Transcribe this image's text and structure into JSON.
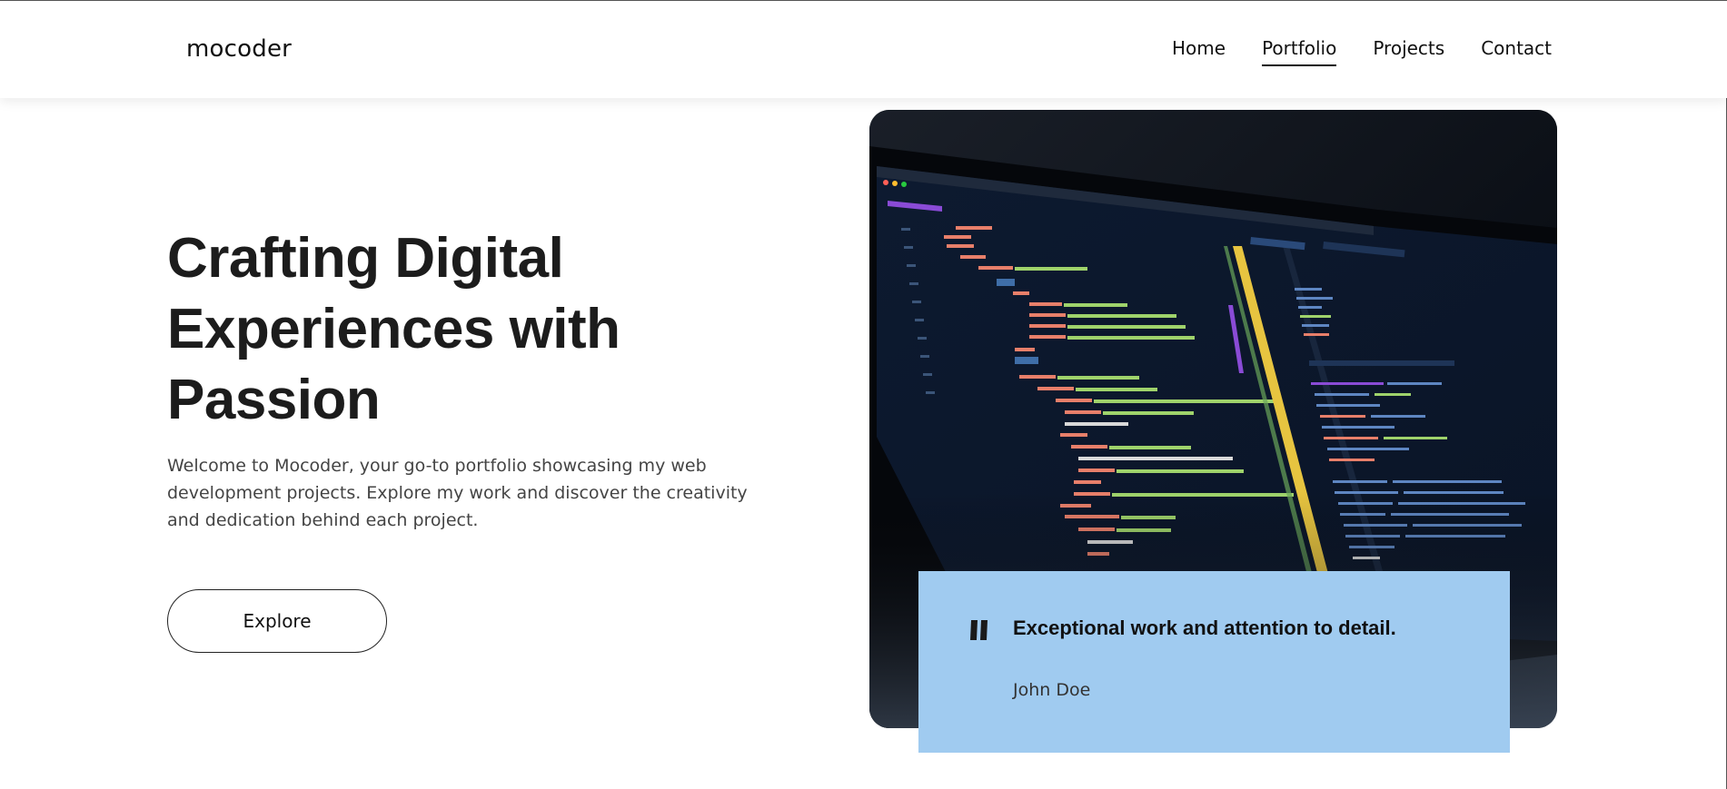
{
  "header": {
    "logo": "mocoder",
    "nav": [
      "Home",
      "Portfolio",
      "Projects",
      "Contact"
    ],
    "active_nav": "Portfolio"
  },
  "hero": {
    "title_lines": [
      "Crafting Digital",
      "Experiences with",
      "Passion"
    ],
    "description": "Welcome to Mocoder, your go-to portfolio showcasing my web development projects. Explore my work and discover the creativity and dedication behind each project.",
    "button_label": "Explore",
    "image_icon": "laptop-code-photo"
  },
  "testimonial": {
    "icon": "quote-icon",
    "quote": "Exceptional work and attention to detail.",
    "author": "John Doe"
  },
  "colors": {
    "testimonial_bg": "#a0cbf0",
    "text_dark": "#1c1c1c",
    "text_body": "#444444",
    "image_dark": "#0c1119"
  }
}
